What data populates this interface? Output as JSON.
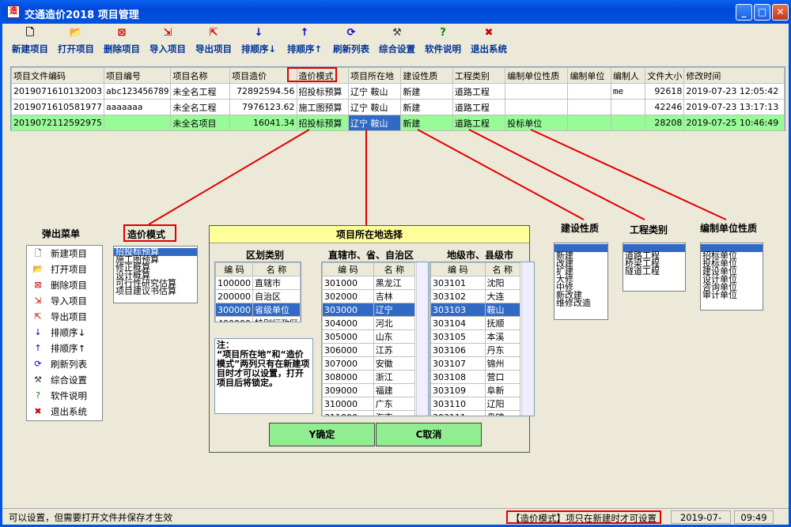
{
  "window": {
    "title": "交通造价2018  项目管理",
    "min": "_",
    "max": "□",
    "close": "✕"
  },
  "toolbar": [
    {
      "label": "新建项目",
      "icon": "new-file-icon"
    },
    {
      "label": "打开项目",
      "icon": "open-folder-icon"
    },
    {
      "label": "删除项目",
      "icon": "delete-icon"
    },
    {
      "label": "导入项目",
      "icon": "import-icon"
    },
    {
      "label": "导出项目",
      "icon": "export-icon"
    },
    {
      "label": "排顺序↓",
      "icon": "sort-desc-icon"
    },
    {
      "label": "排顺序↑",
      "icon": "sort-asc-icon"
    },
    {
      "label": "刷新列表",
      "icon": "refresh-icon"
    },
    {
      "label": "综合设置",
      "icon": "settings-icon"
    },
    {
      "label": "软件说明",
      "icon": "help-icon"
    },
    {
      "label": "退出系统",
      "icon": "exit-icon"
    }
  ],
  "grid": {
    "headers": [
      "项目文件编码",
      "项目编号",
      "项目名称",
      "项目造价",
      "造价模式",
      "项目所在地",
      "建设性质",
      "工程类别",
      "编制单位性质",
      "编制单位",
      "编制人",
      "文件大小",
      "修改时间"
    ],
    "rows": [
      [
        "2019071610132003",
        "abc123456789",
        "未全名工程",
        "72892594.56",
        "招投标预算",
        "辽宁 鞍山",
        "新建",
        "道路工程",
        "",
        "",
        "me",
        "92618",
        "2019-07-23 12:05:42"
      ],
      [
        "2019071610581977",
        "aaaaaaa",
        "未全名工程",
        "7976123.62",
        "施工图预算",
        "辽宁 鞍山",
        "新建",
        "道路工程",
        "",
        "",
        "",
        "42246",
        "2019-07-23 13:17:13"
      ],
      [
        "2019072112592975",
        "",
        "未全名项目",
        "16041.34",
        "招投标预算",
        "辽宁 鞍山",
        "新建",
        "道路工程",
        "投标单位",
        "",
        "",
        "28208",
        "2019-07-25 10:46:49"
      ]
    ]
  },
  "popup_menu": {
    "title": "弹出菜单",
    "items": [
      {
        "label": "新建项目",
        "icon": "new-file-icon"
      },
      {
        "label": "打开项目",
        "icon": "open-folder-icon"
      },
      {
        "label": "删除项目",
        "icon": "delete-icon"
      },
      {
        "label": "导入项目",
        "icon": "import-icon"
      },
      {
        "label": "导出项目",
        "icon": "export-icon"
      },
      {
        "label": "排顺序↓",
        "icon": "sort-desc-icon"
      },
      {
        "label": "排顺序↑",
        "icon": "sort-asc-icon"
      },
      {
        "label": "刷新列表",
        "icon": "refresh-icon"
      },
      {
        "label": "综合设置",
        "icon": "settings-icon"
      },
      {
        "label": "软件说明",
        "icon": "help-icon"
      },
      {
        "label": "退出系统",
        "icon": "exit-icon"
      }
    ]
  },
  "price_mode": {
    "title": "造价模式",
    "items": [
      "招投标预算",
      "施工图预算",
      "修正概算",
      "设计概算",
      "可行性研究估算",
      "项目建议书估算"
    ],
    "selected": 0
  },
  "build_nature": {
    "title": "建设性质",
    "items": [
      "",
      "新建",
      "改建",
      "扩建",
      "大修",
      "中修",
      "新改建",
      "维修改造"
    ]
  },
  "project_type": {
    "title": "工程类别",
    "items": [
      "",
      "道路工程",
      "桥梁工程",
      "隧道工程"
    ]
  },
  "org_nature": {
    "title": "编制单位性质",
    "items": [
      "",
      "招标单位",
      "投标单位",
      "建设单位",
      "设计单位",
      "咨询单位",
      "审计单位"
    ]
  },
  "dialog": {
    "title": "项目所在地选择",
    "col1_title": "区划类别",
    "col2_title": "直辖市、省、自治区",
    "col3_title": "地级市、县级市",
    "code_header": "编  码",
    "name_header": "名  称",
    "regions": [
      [
        "100000",
        "直辖市"
      ],
      [
        "200000",
        "自治区"
      ],
      [
        "300000",
        "省级单位"
      ],
      [
        "400000",
        "特别行政区"
      ]
    ],
    "provinces": [
      [
        "301000",
        "黑龙江"
      ],
      [
        "302000",
        "吉林"
      ],
      [
        "303000",
        "辽宁"
      ],
      [
        "304000",
        "河北"
      ],
      [
        "305000",
        "山东"
      ],
      [
        "306000",
        "江苏"
      ],
      [
        "307000",
        "安徽"
      ],
      [
        "308000",
        "浙江"
      ],
      [
        "309000",
        "福建"
      ],
      [
        "310000",
        "广东"
      ],
      [
        "311000",
        "海南"
      ],
      [
        "312000",
        "云南"
      ]
    ],
    "cities": [
      [
        "303101",
        "沈阳"
      ],
      [
        "303102",
        "大连"
      ],
      [
        "303103",
        "鞍山"
      ],
      [
        "303104",
        "抚顺"
      ],
      [
        "303105",
        "本溪"
      ],
      [
        "303106",
        "丹东"
      ],
      [
        "303107",
        "锦州"
      ],
      [
        "303108",
        "营口"
      ],
      [
        "303109",
        "阜新"
      ],
      [
        "303110",
        "辽阳"
      ],
      [
        "303111",
        "盘锦"
      ],
      [
        "303112",
        "铁岭"
      ]
    ],
    "note": "注：\n“项目所在地”和“造价模式”两列只有在新建项目时才可以设置，打开项目后将锁定。",
    "ok": "Y确定",
    "cancel": "C取消"
  },
  "status": {
    "left": "可以设置，但需要打开文件并保存才生效",
    "hint": "【造价模式】项只在新建时才可设置",
    "date": "2019-07-26",
    "time": "09:49"
  }
}
